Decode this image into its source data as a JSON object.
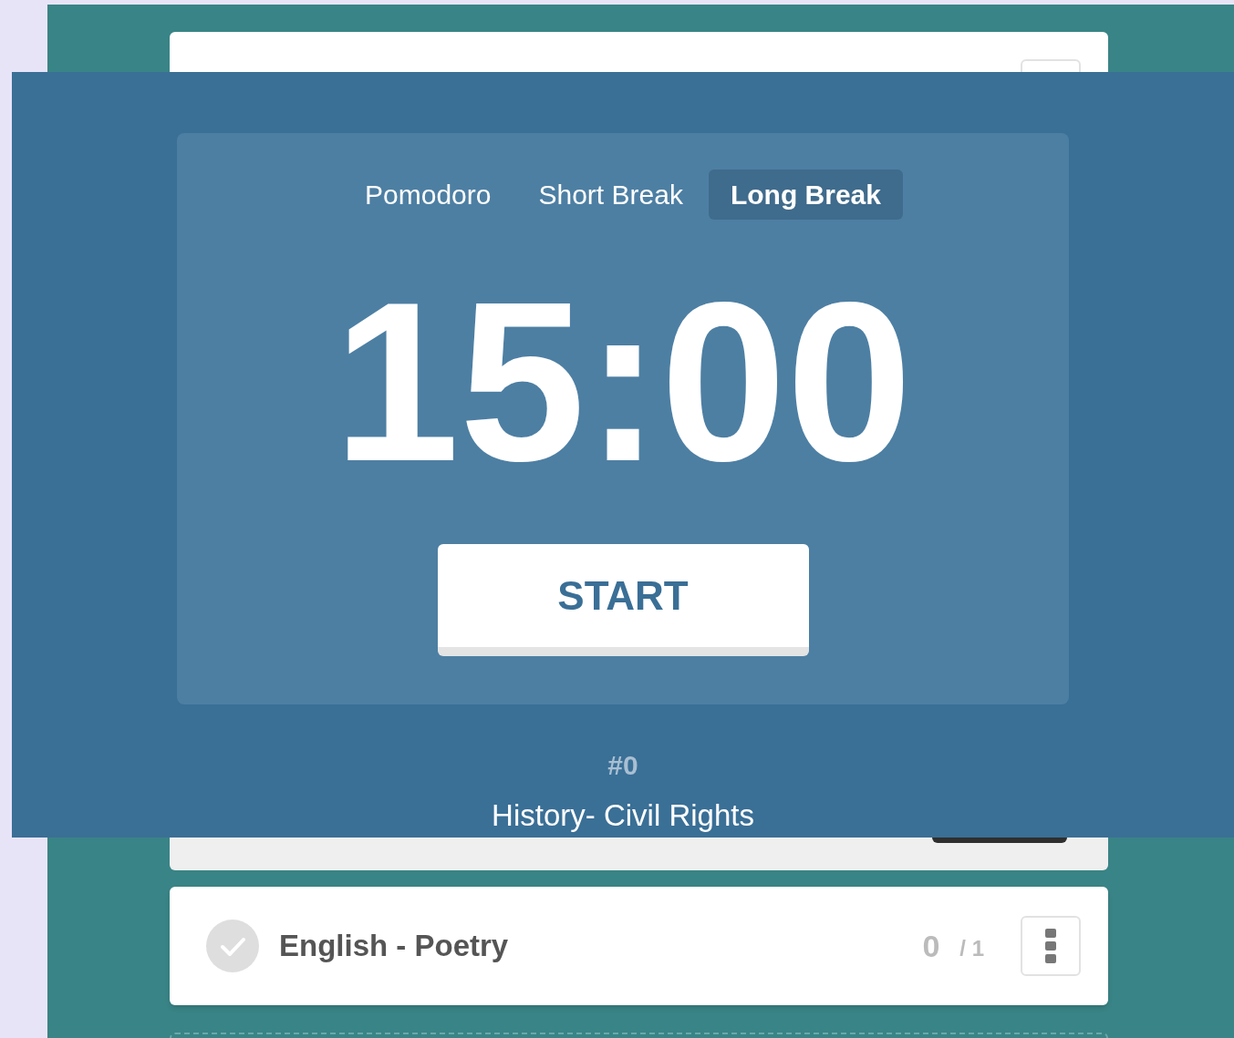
{
  "timer": {
    "tabs": [
      {
        "label": "Pomodoro",
        "selected": false
      },
      {
        "label": "Short Break",
        "selected": false
      },
      {
        "label": "Long Break",
        "selected": true
      }
    ],
    "time": "15:00",
    "button": "START",
    "session": "#0",
    "current_task": "History- Civil Rights"
  },
  "tasks": [
    {
      "title": "English - Poetry",
      "done": false,
      "count": "0",
      "total": "/ 1"
    }
  ]
}
